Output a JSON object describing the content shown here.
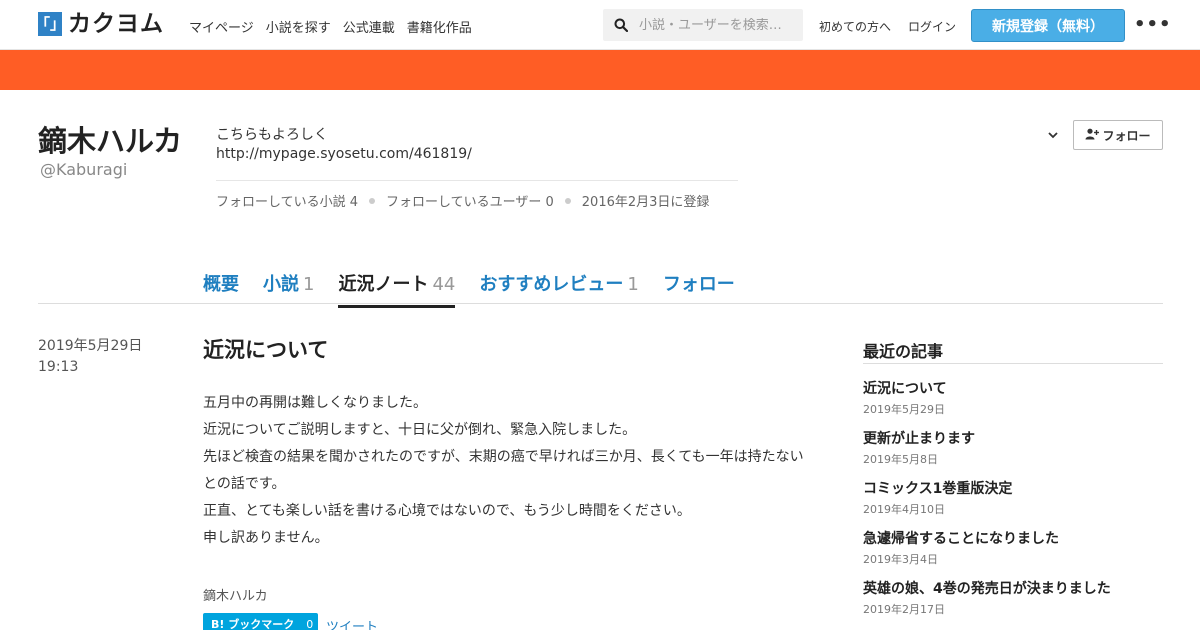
{
  "header": {
    "logo_mark": "「」",
    "logo_text": "カクヨム",
    "nav": [
      "マイページ",
      "小説を探す",
      "公式連載",
      "書籍化作品"
    ],
    "search_placeholder": "小説・ユーザーを検索…",
    "first_time": "初めての方へ",
    "login": "ログイン",
    "register": "新規登録（無料）",
    "more": "•••"
  },
  "colors": {
    "banner": "#ff5d25",
    "accent": "#1f7fc0",
    "register_button": "#4aaee6",
    "bookmark": "#00a4de"
  },
  "profile": {
    "name": "鏑木ハルカ",
    "user_id": "@Kaburagi",
    "bio_line1": "こちらもよろしく",
    "bio_line2": "http://mypage.syosetu.com/461819/",
    "stats": [
      "フォローしている小説 4",
      "フォローしているユーザー 0",
      "2016年2月3日に登録"
    ],
    "follow_label": "フォロー"
  },
  "tabs": [
    {
      "label": "概要",
      "count": ""
    },
    {
      "label": "小説",
      "count": "1"
    },
    {
      "label": "近況ノート",
      "count": "44"
    },
    {
      "label": "おすすめレビュー",
      "count": "1"
    },
    {
      "label": "フォロー",
      "count": ""
    }
  ],
  "post": {
    "date": "2019年5月29日",
    "time": "19:13",
    "title": "近況について",
    "body": [
      "五月中の再開は難しくなりました。",
      "近況についてご説明しますと、十日に父が倒れ、緊急入院しました。",
      "先ほど検査の結果を聞かされたのですが、末期の癌で早ければ三か月、長くても一年は持たないとの話です。",
      "正直、とても楽しい話を書ける心境ではないので、もう少し時間をください。",
      "申し訳ありません。"
    ],
    "author": "鏑木ハルカ",
    "bookmark_label": "B! ブックマーク",
    "bookmark_count": "0",
    "tweet_label": "ツイート"
  },
  "sidebar": {
    "heading": "最近の記事",
    "items": [
      {
        "title": "近況について",
        "date": "2019年5月29日"
      },
      {
        "title": "更新が止まります",
        "date": "2019年5月8日"
      },
      {
        "title": "コミックス1巻重版決定",
        "date": "2019年4月10日"
      },
      {
        "title": "急遽帰省することになりました",
        "date": "2019年3月4日"
      },
      {
        "title": "英雄の娘、4巻の発売日が決まりました",
        "date": "2019年2月17日"
      }
    ]
  }
}
